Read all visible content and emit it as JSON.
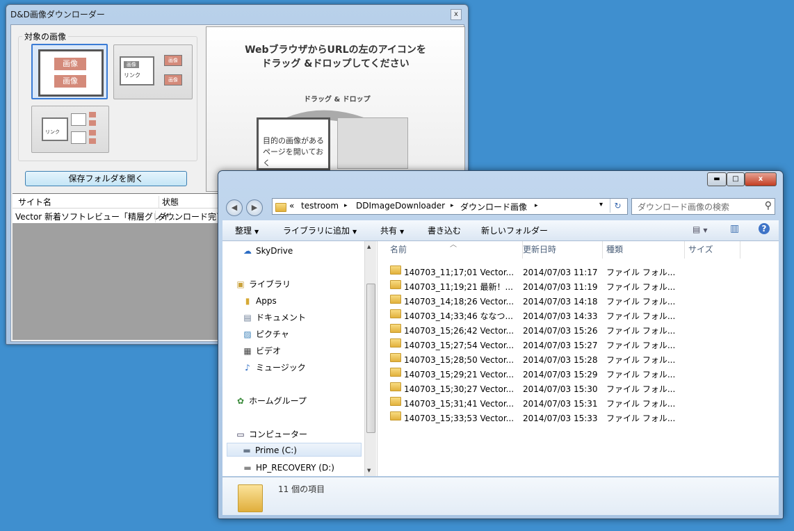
{
  "downloader": {
    "title": "D&D画像ダウンローダー",
    "close_glyph": "x",
    "group_label": "対象の画像",
    "thumb_text": {
      "image": "画像",
      "link": "リンク"
    },
    "open_folder_button": "保存フォルダを開く",
    "instruction_line1": "WebブラウザからURLの左のアイコンを",
    "instruction_line2": "ドラッグ &ドロップしてください",
    "dnd_label": "ドラッグ & ドロップ",
    "illustration_text_1": "目的の画像がある",
    "illustration_text_2": "ページを開いておく",
    "list_headers": [
      "サイト名",
      "状態"
    ],
    "list_rows": [
      {
        "site": "Vector 新着ソフトレビュー「精層グレイ...",
        "status": "ダウンロード完了"
      }
    ]
  },
  "explorer": {
    "window_controls": {
      "minimize": "▬",
      "maximize": "□",
      "close": "x"
    },
    "nav": {
      "back": "◀",
      "forward": "▶"
    },
    "address": {
      "prefix": "«",
      "crumbs": [
        "testroom",
        "DDImageDownloader",
        "ダウンロード画像"
      ],
      "separator": "▸",
      "dropdown": "▾",
      "refresh": "↻"
    },
    "search": {
      "placeholder": "ダウンロード画像の検索",
      "icon": "search-icon"
    },
    "toolbar": [
      "整理",
      "ライブラリに追加",
      "共有",
      "書き込む",
      "新しいフォルダー"
    ],
    "toolbar_dropdowns": [
      true,
      true,
      true,
      false,
      false
    ],
    "view_icon": "▤",
    "pane_icon": "▥",
    "help_icon": "?",
    "nav_items": [
      {
        "label": "SkyDrive",
        "icon": "cloud-icon",
        "glyph": "☁"
      },
      {
        "label": "ライブラリ",
        "icon": "library-icon",
        "glyph": "▣"
      },
      {
        "label": "Apps",
        "icon": "folder-icon",
        "glyph": "▮"
      },
      {
        "label": "ドキュメント",
        "icon": "document-icon",
        "glyph": "▤"
      },
      {
        "label": "ピクチャ",
        "icon": "picture-icon",
        "glyph": "▨"
      },
      {
        "label": "ビデオ",
        "icon": "video-icon",
        "glyph": "▦"
      },
      {
        "label": "ミュージック",
        "icon": "music-icon",
        "glyph": "♪"
      },
      {
        "label": "ホームグループ",
        "icon": "homegroup-icon",
        "glyph": "✿"
      },
      {
        "label": "コンピューター",
        "icon": "computer-icon",
        "glyph": "▭"
      },
      {
        "label": "Prime (C:)",
        "icon": "drive-icon",
        "glyph": "▬"
      },
      {
        "label": "HP_RECOVERY (D:)",
        "icon": "drive-icon",
        "glyph": "▬"
      }
    ],
    "columns": [
      "名前",
      "更新日時",
      "種類",
      "サイズ"
    ],
    "sort_indicator": "︿",
    "files": [
      {
        "name": "140703_11;17;01 Vector...",
        "date": "2014/07/03 11:17",
        "type": "ファイル フォル..."
      },
      {
        "name": "140703_11;19;21 最新！...",
        "date": "2014/07/03 11:19",
        "type": "ファイル フォル..."
      },
      {
        "name": "140703_14;18;26 Vector...",
        "date": "2014/07/03 14:18",
        "type": "ファイル フォル..."
      },
      {
        "name": "140703_14;33;46 ななつ...",
        "date": "2014/07/03 14:33",
        "type": "ファイル フォル..."
      },
      {
        "name": "140703_15;26;42 Vector...",
        "date": "2014/07/03 15:26",
        "type": "ファイル フォル..."
      },
      {
        "name": "140703_15;27;54 Vector...",
        "date": "2014/07/03 15:27",
        "type": "ファイル フォル..."
      },
      {
        "name": "140703_15;28;50 Vector...",
        "date": "2014/07/03 15:28",
        "type": "ファイル フォル..."
      },
      {
        "name": "140703_15;29;21 Vector...",
        "date": "2014/07/03 15:29",
        "type": "ファイル フォル..."
      },
      {
        "name": "140703_15;30;27 Vector...",
        "date": "2014/07/03 15:30",
        "type": "ファイル フォル..."
      },
      {
        "name": "140703_15;31;41 Vector...",
        "date": "2014/07/03 15:31",
        "type": "ファイル フォル..."
      },
      {
        "name": "140703_15;33;53 Vector...",
        "date": "2014/07/03 15:33",
        "type": "ファイル フォル..."
      }
    ],
    "item_count": "11 個の項目"
  }
}
